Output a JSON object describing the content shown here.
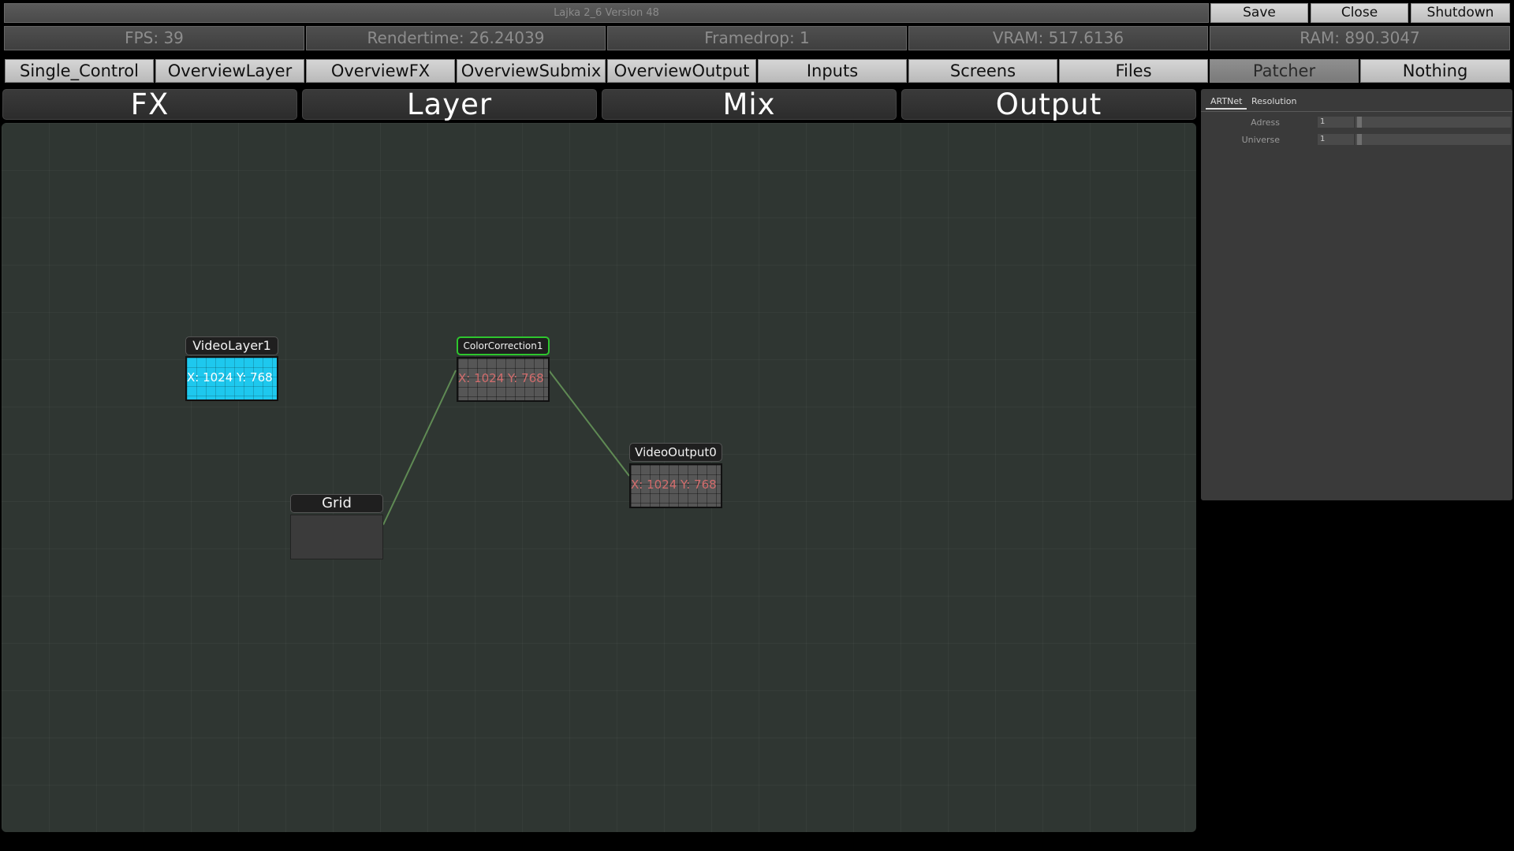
{
  "window": {
    "title": "Lajka 2_6 Version 48",
    "buttons": {
      "save": "Save",
      "close": "Close",
      "shutdown": "Shutdown"
    }
  },
  "stats": {
    "fps": "FPS: 39",
    "rendertime": "Rendertime: 26.24039",
    "framedrop": "Framedrop: 1",
    "vram": "VRAM: 517.6136",
    "ram": "RAM: 890.3047"
  },
  "nav": {
    "tabs": [
      "Single_Control",
      "OverviewLayer",
      "OverviewFX",
      "OverviewSubmix",
      "OverviewOutput",
      "Inputs",
      "Screens",
      "Files",
      "Patcher",
      "Nothing"
    ],
    "active": "Patcher"
  },
  "sections": [
    "FX",
    "Layer",
    "Mix",
    "Output"
  ],
  "nodes": {
    "videolayer": {
      "title": "VideoLayer1",
      "preview": "X: 1024 Y: 768"
    },
    "colorcorrection": {
      "title": "ColorCorrection1",
      "preview": "X: 1024 Y: 768"
    },
    "videooutput": {
      "title": "VideoOutput0",
      "preview": "X: 1024 Y: 768"
    },
    "grid": {
      "title": "Grid"
    }
  },
  "panel": {
    "tabs": [
      "ARTNet",
      "Resolution"
    ],
    "active_tab": "ARTNet",
    "rows": [
      {
        "label": "Adress",
        "value": "1"
      },
      {
        "label": "Universe",
        "value": "1"
      }
    ]
  },
  "colors": {
    "canvas": "#2f3632",
    "selected_border": "#2ec62e",
    "connection": "#5f8a54",
    "preview_cyan": "#1ec8ee"
  }
}
